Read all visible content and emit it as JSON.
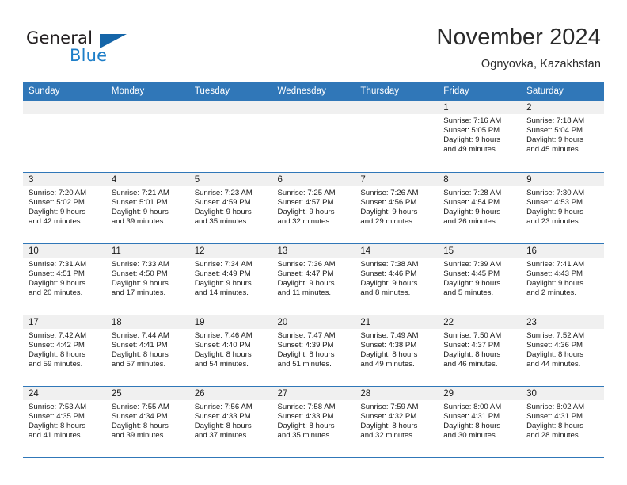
{
  "logo": {
    "word1": "General",
    "word2": "Blue",
    "triangle_icon": "triangle-icon",
    "accent_dark": "#1565a8",
    "accent_blue": "#1d7ec8"
  },
  "header": {
    "month_title": "November 2024",
    "location": "Ognyovka, Kazakhstan"
  },
  "theme": {
    "header_bg": "#3077b8",
    "daynum_bg": "#f0f0f0",
    "grid_line": "#3077b8"
  },
  "weekday_headers": [
    "Sunday",
    "Monday",
    "Tuesday",
    "Wednesday",
    "Thursday",
    "Friday",
    "Saturday"
  ],
  "weeks": [
    [
      {
        "day": "",
        "lines": []
      },
      {
        "day": "",
        "lines": []
      },
      {
        "day": "",
        "lines": []
      },
      {
        "day": "",
        "lines": []
      },
      {
        "day": "",
        "lines": []
      },
      {
        "day": "1",
        "lines": [
          "Sunrise: 7:16 AM",
          "Sunset: 5:05 PM",
          "Daylight: 9 hours",
          "and 49 minutes."
        ]
      },
      {
        "day": "2",
        "lines": [
          "Sunrise: 7:18 AM",
          "Sunset: 5:04 PM",
          "Daylight: 9 hours",
          "and 45 minutes."
        ]
      }
    ],
    [
      {
        "day": "3",
        "lines": [
          "Sunrise: 7:20 AM",
          "Sunset: 5:02 PM",
          "Daylight: 9 hours",
          "and 42 minutes."
        ]
      },
      {
        "day": "4",
        "lines": [
          "Sunrise: 7:21 AM",
          "Sunset: 5:01 PM",
          "Daylight: 9 hours",
          "and 39 minutes."
        ]
      },
      {
        "day": "5",
        "lines": [
          "Sunrise: 7:23 AM",
          "Sunset: 4:59 PM",
          "Daylight: 9 hours",
          "and 35 minutes."
        ]
      },
      {
        "day": "6",
        "lines": [
          "Sunrise: 7:25 AM",
          "Sunset: 4:57 PM",
          "Daylight: 9 hours",
          "and 32 minutes."
        ]
      },
      {
        "day": "7",
        "lines": [
          "Sunrise: 7:26 AM",
          "Sunset: 4:56 PM",
          "Daylight: 9 hours",
          "and 29 minutes."
        ]
      },
      {
        "day": "8",
        "lines": [
          "Sunrise: 7:28 AM",
          "Sunset: 4:54 PM",
          "Daylight: 9 hours",
          "and 26 minutes."
        ]
      },
      {
        "day": "9",
        "lines": [
          "Sunrise: 7:30 AM",
          "Sunset: 4:53 PM",
          "Daylight: 9 hours",
          "and 23 minutes."
        ]
      }
    ],
    [
      {
        "day": "10",
        "lines": [
          "Sunrise: 7:31 AM",
          "Sunset: 4:51 PM",
          "Daylight: 9 hours",
          "and 20 minutes."
        ]
      },
      {
        "day": "11",
        "lines": [
          "Sunrise: 7:33 AM",
          "Sunset: 4:50 PM",
          "Daylight: 9 hours",
          "and 17 minutes."
        ]
      },
      {
        "day": "12",
        "lines": [
          "Sunrise: 7:34 AM",
          "Sunset: 4:49 PM",
          "Daylight: 9 hours",
          "and 14 minutes."
        ]
      },
      {
        "day": "13",
        "lines": [
          "Sunrise: 7:36 AM",
          "Sunset: 4:47 PM",
          "Daylight: 9 hours",
          "and 11 minutes."
        ]
      },
      {
        "day": "14",
        "lines": [
          "Sunrise: 7:38 AM",
          "Sunset: 4:46 PM",
          "Daylight: 9 hours",
          "and 8 minutes."
        ]
      },
      {
        "day": "15",
        "lines": [
          "Sunrise: 7:39 AM",
          "Sunset: 4:45 PM",
          "Daylight: 9 hours",
          "and 5 minutes."
        ]
      },
      {
        "day": "16",
        "lines": [
          "Sunrise: 7:41 AM",
          "Sunset: 4:43 PM",
          "Daylight: 9 hours",
          "and 2 minutes."
        ]
      }
    ],
    [
      {
        "day": "17",
        "lines": [
          "Sunrise: 7:42 AM",
          "Sunset: 4:42 PM",
          "Daylight: 8 hours",
          "and 59 minutes."
        ]
      },
      {
        "day": "18",
        "lines": [
          "Sunrise: 7:44 AM",
          "Sunset: 4:41 PM",
          "Daylight: 8 hours",
          "and 57 minutes."
        ]
      },
      {
        "day": "19",
        "lines": [
          "Sunrise: 7:46 AM",
          "Sunset: 4:40 PM",
          "Daylight: 8 hours",
          "and 54 minutes."
        ]
      },
      {
        "day": "20",
        "lines": [
          "Sunrise: 7:47 AM",
          "Sunset: 4:39 PM",
          "Daylight: 8 hours",
          "and 51 minutes."
        ]
      },
      {
        "day": "21",
        "lines": [
          "Sunrise: 7:49 AM",
          "Sunset: 4:38 PM",
          "Daylight: 8 hours",
          "and 49 minutes."
        ]
      },
      {
        "day": "22",
        "lines": [
          "Sunrise: 7:50 AM",
          "Sunset: 4:37 PM",
          "Daylight: 8 hours",
          "and 46 minutes."
        ]
      },
      {
        "day": "23",
        "lines": [
          "Sunrise: 7:52 AM",
          "Sunset: 4:36 PM",
          "Daylight: 8 hours",
          "and 44 minutes."
        ]
      }
    ],
    [
      {
        "day": "24",
        "lines": [
          "Sunrise: 7:53 AM",
          "Sunset: 4:35 PM",
          "Daylight: 8 hours",
          "and 41 minutes."
        ]
      },
      {
        "day": "25",
        "lines": [
          "Sunrise: 7:55 AM",
          "Sunset: 4:34 PM",
          "Daylight: 8 hours",
          "and 39 minutes."
        ]
      },
      {
        "day": "26",
        "lines": [
          "Sunrise: 7:56 AM",
          "Sunset: 4:33 PM",
          "Daylight: 8 hours",
          "and 37 minutes."
        ]
      },
      {
        "day": "27",
        "lines": [
          "Sunrise: 7:58 AM",
          "Sunset: 4:33 PM",
          "Daylight: 8 hours",
          "and 35 minutes."
        ]
      },
      {
        "day": "28",
        "lines": [
          "Sunrise: 7:59 AM",
          "Sunset: 4:32 PM",
          "Daylight: 8 hours",
          "and 32 minutes."
        ]
      },
      {
        "day": "29",
        "lines": [
          "Sunrise: 8:00 AM",
          "Sunset: 4:31 PM",
          "Daylight: 8 hours",
          "and 30 minutes."
        ]
      },
      {
        "day": "30",
        "lines": [
          "Sunrise: 8:02 AM",
          "Sunset: 4:31 PM",
          "Daylight: 8 hours",
          "and 28 minutes."
        ]
      }
    ]
  ]
}
